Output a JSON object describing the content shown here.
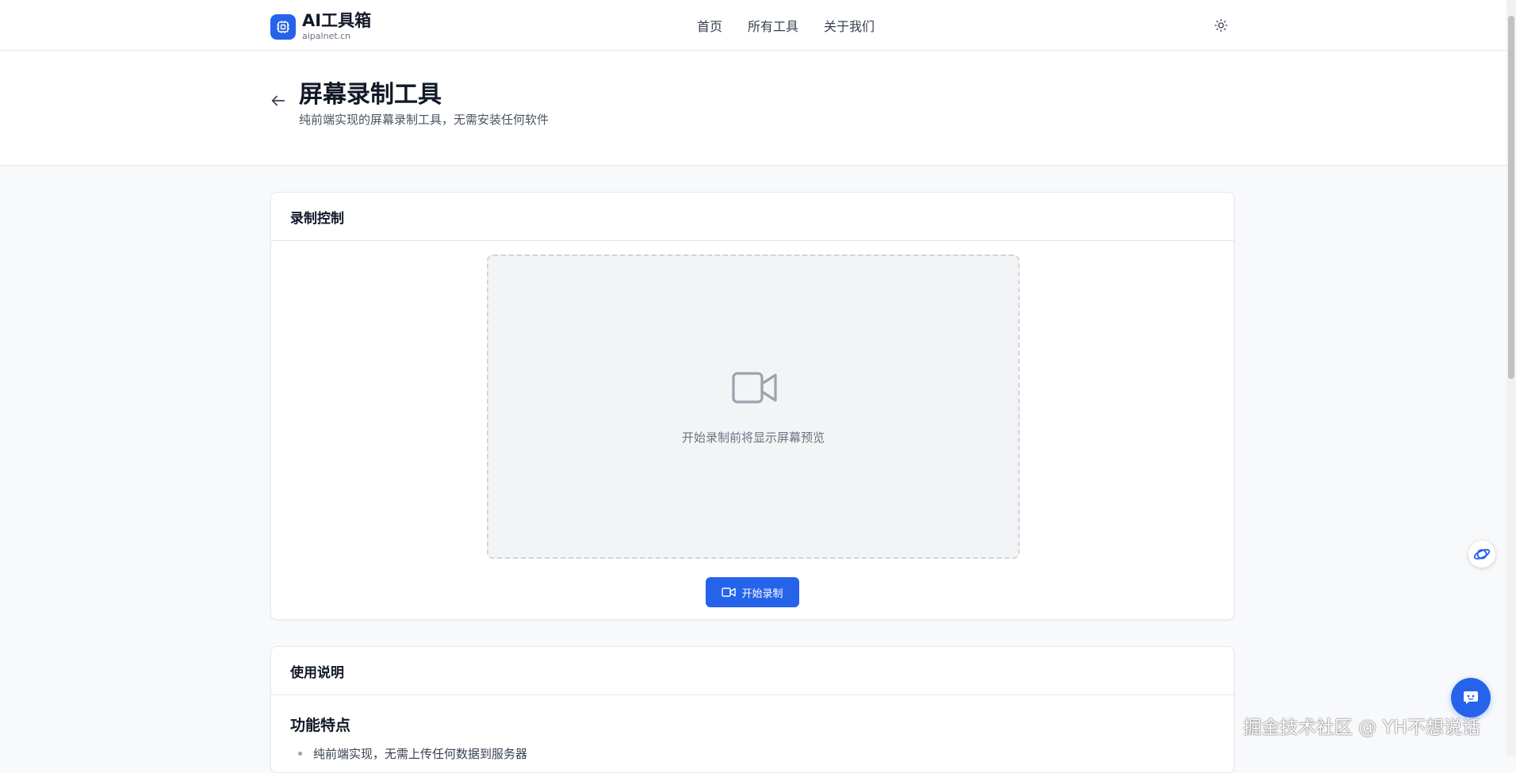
{
  "header": {
    "logo_title": "AI工具箱",
    "logo_subtitle": "aipalnet.cn",
    "nav": [
      "首页",
      "所有工具",
      "关于我们"
    ],
    "theme_icon": "sun-icon"
  },
  "hero": {
    "title": "屏幕录制工具",
    "subtitle": "纯前端实现的屏幕录制工具，无需安装任何软件"
  },
  "recording_card": {
    "title": "录制控制",
    "preview_text": "开始录制前将显示屏幕预览",
    "start_button": "开始录制"
  },
  "instructions_card": {
    "title": "使用说明",
    "section_title": "功能特点",
    "features": [
      "纯前端实现，无需上传任何数据到服务器"
    ]
  },
  "watermark": "掘金技术社区 @ YH不想说话",
  "colors": {
    "primary": "#2563eb",
    "background": "#f8f9fb",
    "card": "#ffffff",
    "border": "#e5e7eb"
  }
}
